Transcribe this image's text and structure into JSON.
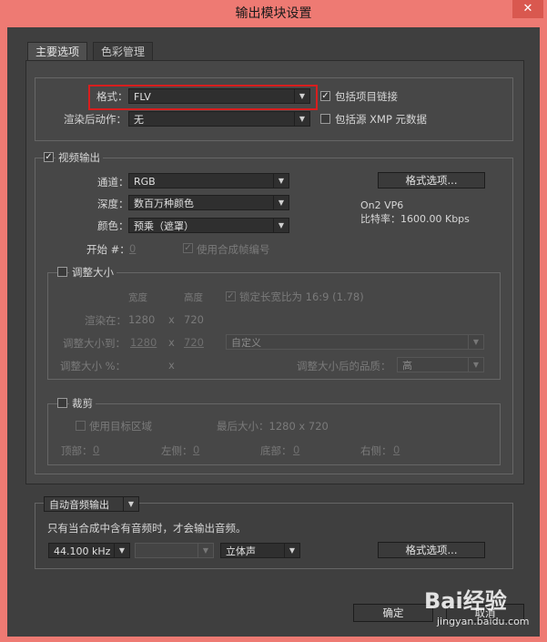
{
  "window": {
    "title": "输出模块设置",
    "close_glyph": "✕"
  },
  "tabs": [
    {
      "label": "主要选项"
    },
    {
      "label": "色彩管理"
    }
  ],
  "format_section": {
    "format_label": "格式：",
    "format_value": "FLV",
    "post_render_label": "渲染后动作：",
    "post_render_value": "无",
    "include_project_link_label": "包括项目链接",
    "include_source_xmp_label": "包括源 XMP 元数据"
  },
  "video": {
    "title": "视频输出",
    "channels_label": "通道：",
    "channels_value": "RGB",
    "depth_label": "深度：",
    "depth_value": "数百万种颜色",
    "color_label": "颜色：",
    "color_value": "预乘（遮罩）",
    "start_label": "开始 #：",
    "start_value": "0",
    "use_comp_frame_label": "使用合成帧编号",
    "format_options_label": "格式选项...",
    "codec_info": "On2 VP6",
    "bitrate_info": "比特率：1600.00 Kbps"
  },
  "resize": {
    "title": "调整大小",
    "width_header": "宽度",
    "height_header": "高度",
    "lock_aspect_label": "锁定长宽比为 16:9 (1.78)",
    "render_at_label": "渲染在：",
    "render_w": "1280",
    "render_h": "720",
    "resize_to_label": "调整大小到：",
    "resize_w": "1280",
    "resize_h": "720",
    "preset_value": "自定义",
    "resize_pct_label": "调整大小 %：",
    "x": "x",
    "quality_label": "调整大小后的品质：",
    "quality_value": "高"
  },
  "crop": {
    "title": "裁剪",
    "use_roi_label": "使用目标区域",
    "final_size_label": "最后大小：1280 x 720",
    "top_label": "顶部：",
    "top_value": "0",
    "left_label": "左侧：",
    "left_value": "0",
    "bottom_label": "底部：",
    "bottom_value": "0",
    "right_label": "右侧：",
    "right_value": "0"
  },
  "audio": {
    "mode_label": "自动音频输出",
    "note": "只有当合成中含有音频时，才会输出音频。",
    "sample_rate": "44.100 kHz",
    "depth_value": "",
    "channels_value": "立体声",
    "format_options_label": "格式选项..."
  },
  "footer": {
    "ok_label": "确定",
    "cancel_label": "取消"
  },
  "watermark": {
    "brand": "Bai经验",
    "url": "jingyan.baidu.com"
  },
  "colors": {
    "frame": "#ee7a73",
    "highlight": "#d81e1e",
    "panel": "#474747"
  }
}
